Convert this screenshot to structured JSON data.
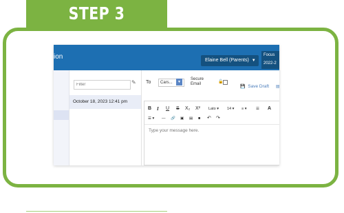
{
  "banner": {
    "text": "STEP 3"
  },
  "app": {
    "title_fragment": "ion",
    "user_menu": "Elaine Bell (Parents)",
    "focus_lines": [
      "Focus",
      "2022-2"
    ]
  },
  "list": {
    "filter_placeholder": "Filter",
    "messages": [
      {
        "date": "October 18, 2023 12:41 pm"
      }
    ]
  },
  "compose": {
    "to_label": "To",
    "to_value": "Cars...",
    "secure_email_label": [
      "Secure",
      "Email"
    ],
    "save_draft_label": "Save Draft",
    "message_placeholder": "Type your message here."
  },
  "toolbar": {
    "row1": [
      "B",
      "I",
      "U",
      "S",
      "X₂",
      "X²",
      "Lato ▾",
      "14 ▾",
      "≡ ▾",
      "☰",
      "A"
    ],
    "row2": [
      "☰ ▾",
      "—",
      "🔗",
      "▣",
      "▤",
      "■",
      "↶",
      "↷"
    ]
  },
  "colors": {
    "accent_green": "#7cb342",
    "header_blue": "#1d6fb2"
  }
}
